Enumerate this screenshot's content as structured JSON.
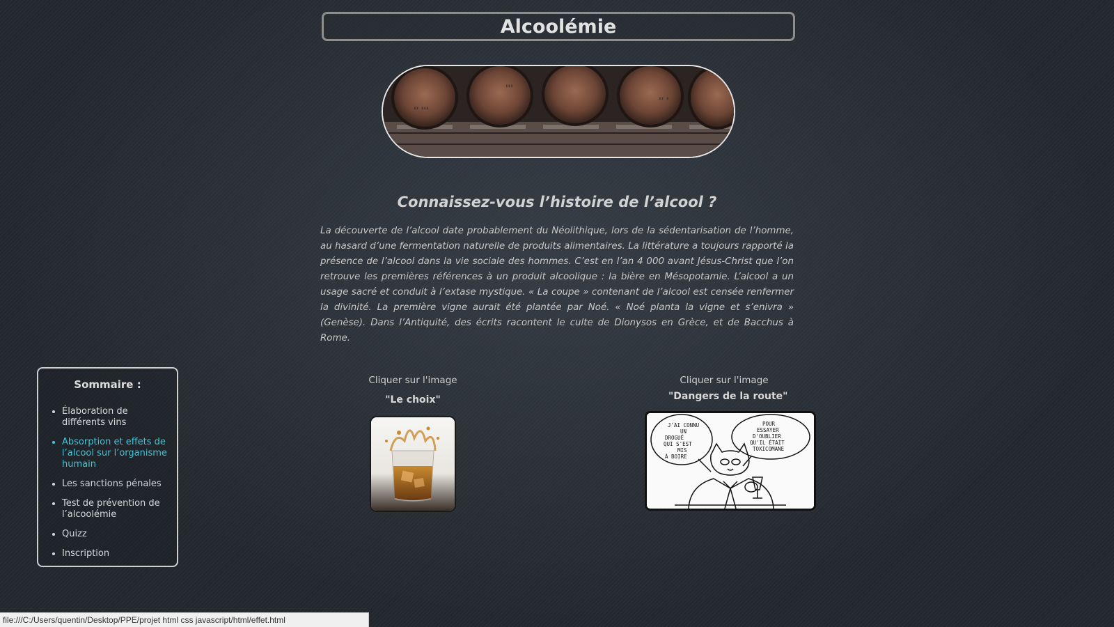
{
  "header": {
    "title": "Alcoolémie"
  },
  "banner": {
    "image": "wine-barrels"
  },
  "article": {
    "heading": "Connaissez-vous l’histoire de l’alcool ?",
    "body": "La découverte de l’alcool date probablement du Néolithique, lors de la sédentarisation de l’homme, au hasard d’une fermentation naturelle de produits alimentaires. La littérature a toujours rapporté la présence de l’alcool dans la vie sociale des hommes. C’est en l’an 4 000 avant Jésus-Christ que l’on retrouve les premières références à un produit alcoolique : la bière en Mésopotamie. L’alcool a un usage sacré et conduit à l’extase mystique. « La coupe » contenant de l’alcool est censée renfermer la divinité. La première vigne aurait été plantée par Noé. « Noé planta la vigne et s’enivra » (Genèse). Dans l’Antiquité, des écrits racontent le culte de Dionysos en Grèce, et de Bacchus à Rome."
  },
  "sommaire": {
    "title": "Sommaire :",
    "items": [
      {
        "label": "Élaboration de différents vins",
        "active": false
      },
      {
        "label": "Absorption et effets de l’alcool sur l’organisme humain",
        "active": true
      },
      {
        "label": "Les sanctions pénales",
        "active": false
      },
      {
        "label": "Test de prévention de l’alcoolémie",
        "active": false
      },
      {
        "label": "Quizz",
        "active": false
      },
      {
        "label": "Inscription",
        "active": false
      }
    ],
    "active_color": "#3fc6d8"
  },
  "cards": [
    {
      "caption": "Cliquer sur l'image",
      "title": "\"Le choix\"",
      "image": "whisky-glass"
    },
    {
      "caption": "Cliquer sur l'image",
      "title": "\"Dangers de la route\"",
      "image": "cartoon-cat"
    }
  ],
  "cartoon": {
    "bubble_left": [
      "J'AI CONNU",
      "UN",
      "DROGUÉ",
      "QUI S'EST",
      "MIS",
      "À BOIRE"
    ],
    "bubble_right": [
      "POUR",
      "ESSAYER",
      "D'OUBLIER",
      "QU'IL ÉTAIT",
      "TOXICOMANE"
    ]
  },
  "status_bar": {
    "url": "file:///C:/Users/quentin/Desktop/PPE/projet html css javascript/html/effet.html"
  }
}
